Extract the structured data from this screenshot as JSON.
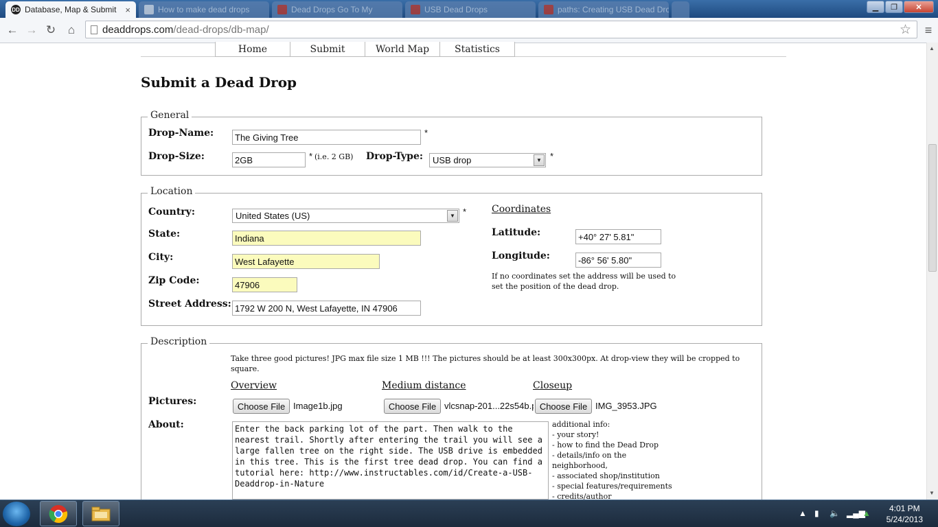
{
  "browser": {
    "tabs": [
      {
        "title": "Database, Map & Submit",
        "active": true
      },
      {
        "title": "How to make dead drops",
        "active": false
      },
      {
        "title": "Dead Drops Go To My",
        "active": false
      },
      {
        "title": "USB Dead Drops",
        "active": false
      },
      {
        "title": "paths: Creating USB Dead Drops",
        "active": false
      }
    ],
    "url_domain": "deaddrops.com",
    "url_path": "/dead-drops/db-map/"
  },
  "site_nav": [
    "Home",
    "Submit",
    "World Map",
    "Statistics"
  ],
  "page_title": "Submit a Dead Drop",
  "general": {
    "legend": "General",
    "drop_name_label": "Drop-Name:",
    "drop_name_value": "The Giving Tree",
    "drop_size_label": "Drop-Size:",
    "drop_size_value": "2GB",
    "drop_size_hint": "(i.e. 2 GB)",
    "drop_type_label": "Drop-Type:",
    "drop_type_value": "USB drop",
    "required_mark": "*"
  },
  "location": {
    "legend": "Location",
    "country_label": "Country:",
    "country_value": "United States (US)",
    "state_label": "State:",
    "state_value": "Indiana",
    "city_label": "City:",
    "city_value": "West Lafayette",
    "zip_label": "Zip Code:",
    "zip_value": "47906",
    "street_label": "Street Address:",
    "street_value": "1792 W 200 N, West Lafayette, IN 47906",
    "coordinates_link": "Coordinates",
    "latitude_label": "Latitude:",
    "latitude_value": "+40° 27' 5.81\"",
    "longitude_label": "Longitude:",
    "longitude_value": "-86° 56' 5.80\"",
    "coords_note_line1": "If no coordinates set the address will be used to",
    "coords_note_line2": "set the position of the dead drop."
  },
  "description": {
    "legend": "Description",
    "pictures_note_line1": "Take three good pictures! JPG max file size 1 MB !!! The pictures should be at least 300x300px. At drop-view they will be cropped to",
    "pictures_note_line2": "square.",
    "pictures_label": "Pictures:",
    "pic_overview": "Overview",
    "pic_medium": "Medium distance",
    "pic_closeup": "Closeup",
    "choose_file": "Choose File",
    "file_overview": "Image1b.jpg",
    "file_medium": "vlcsnap-201...22s54b.p",
    "file_closeup": "IMG_3953.JPG",
    "about_label": "About:",
    "about_text": "Enter the back parking lot of the part. Then walk to the nearest trail. Shortly after entering the trail you will see a large fallen tree on the right side. The USB drive is embedded in this tree. This is the first tree dead drop. You can find a tutorial here: http://www.instructables.com/id/Create-a-USB-Deaddrop-in-Nature",
    "additional_info": "additional info:\n- your story!\n- how to find the Dead Drop\n- details/info on the\nneighborhood,\n- associated shop/institution\n- special features/requirements\n- credits/author"
  },
  "taskbar": {
    "time": "4:01 PM",
    "date": "5/24/2013"
  }
}
